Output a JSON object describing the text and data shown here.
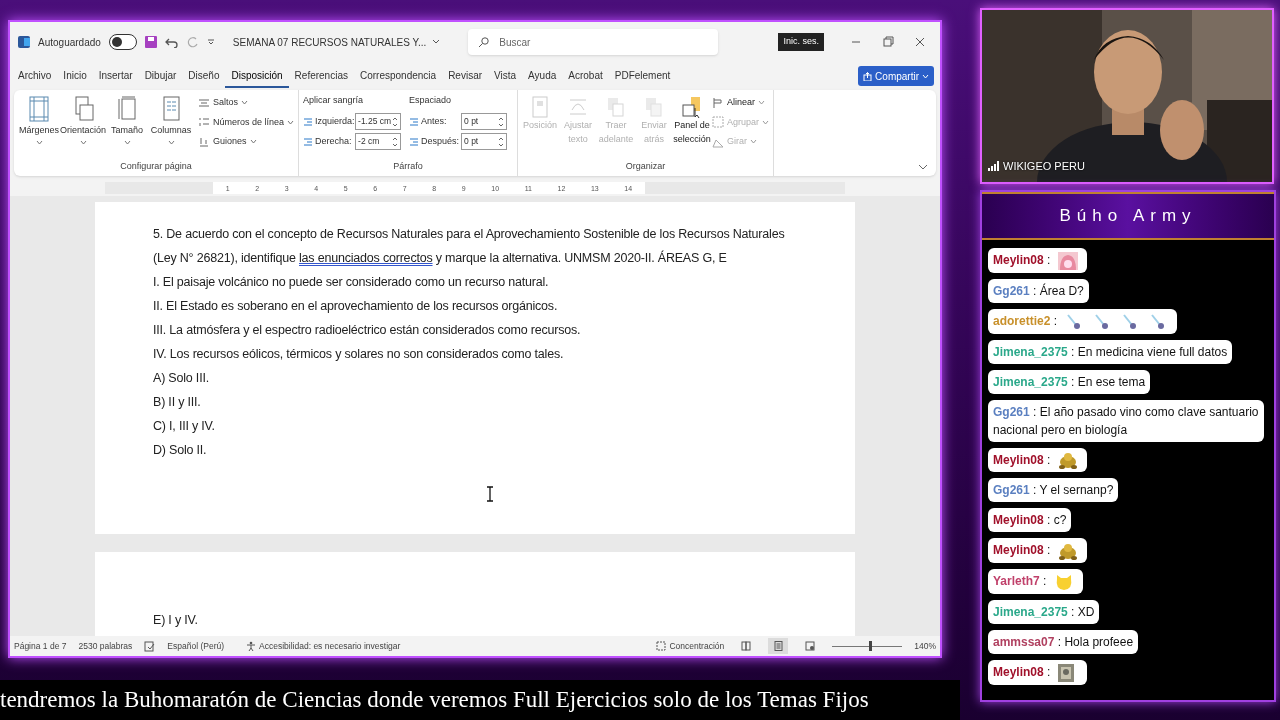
{
  "word": {
    "title_bar": {
      "autosave_label": "Autoguardado",
      "autosave_on": false,
      "doc_title": "SEMANA 07 RECURSOS NATURALES Y...",
      "search_placeholder": "Buscar",
      "signin": "Inic. ses."
    },
    "tabs": [
      {
        "label": "Archivo",
        "selected": false
      },
      {
        "label": "Inicio",
        "selected": false
      },
      {
        "label": "Insertar",
        "selected": false
      },
      {
        "label": "Dibujar",
        "selected": false
      },
      {
        "label": "Diseño",
        "selected": false
      },
      {
        "label": "Disposición",
        "selected": true
      },
      {
        "label": "Referencias",
        "selected": false
      },
      {
        "label": "Correspondencia",
        "selected": false
      },
      {
        "label": "Revisar",
        "selected": false
      },
      {
        "label": "Vista",
        "selected": false
      },
      {
        "label": "Ayuda",
        "selected": false
      },
      {
        "label": "Acrobat",
        "selected": false
      },
      {
        "label": "PDFelement",
        "selected": false
      }
    ],
    "share": "Compartir",
    "page_setup": {
      "label": "Configurar página",
      "large_buttons": [
        "Márgenes",
        "Orientación",
        "Tamaño",
        "Columnas"
      ],
      "small_buttons": [
        "Saltos",
        "Números de línea",
        "Guiones"
      ]
    },
    "paragraph": {
      "label": "Párrafo",
      "indent_label": "Aplicar sangría",
      "spacing_label": "Espaciado",
      "indent_fields": [
        {
          "label": "Izquierda:",
          "value": "-1.25 cm"
        },
        {
          "label": "Derecha:",
          "value": "-2 cm"
        }
      ],
      "spacing_fields": [
        {
          "label": "Antes:",
          "value": "0 pt"
        },
        {
          "label": "Después:",
          "value": "0 pt"
        }
      ]
    },
    "arrange": {
      "label": "Organizar",
      "large_buttons": [
        {
          "label": "Posición",
          "disabled": true
        },
        {
          "label": "Ajustar\ntexto",
          "disabled": true
        },
        {
          "label": "Traer\nadelante",
          "disabled": true
        },
        {
          "label": "Enviar\natrás",
          "disabled": true
        },
        {
          "label": "Panel de\nselección",
          "disabled": false
        }
      ],
      "small_buttons": [
        {
          "label": "Alinear",
          "disabled": false
        },
        {
          "label": "Agrupar",
          "disabled": true
        },
        {
          "label": "Girar",
          "disabled": true
        }
      ]
    },
    "ruler_numbers": [
      "1",
      "2",
      "3",
      "4",
      "5",
      "6",
      "7",
      "8",
      "9",
      "10",
      "11",
      "12",
      "13",
      "14"
    ],
    "pages": [
      {
        "lines": [
          [
            {
              "text": "5. De acuerdo con el concepto de Recursos Naturales para el Aprovechamiento Sostenible de los Recursos Naturales",
              "underline": false
            }
          ],
          [
            {
              "text": "(Ley N° 26821), identifique ",
              "underline": false
            },
            {
              "text": "las enunciados correctos",
              "underline": true
            },
            {
              "text": " y marque la alternativa. UNMSM 2020-II. ÁREAS G, E",
              "underline": false
            }
          ],
          [
            {
              "text": "I. El paisaje volcánico no puede ser considerado como un recurso natural.",
              "underline": false
            }
          ],
          [
            {
              "text": "II. El Estado es soberano en el aprovechamiento de los recursos orgánicos.",
              "underline": false
            }
          ],
          [
            {
              "text": "III. La atmósfera y el espectro radioeléctrico están considerados como recursos.",
              "underline": false
            }
          ],
          [
            {
              "text": "IV. Los recursos eólicos, térmicos y solares no son considerados como tales.",
              "underline": false
            }
          ],
          [
            {
              "text": "A) Solo III.",
              "underline": false
            }
          ],
          [
            {
              "text": "B) II y III.",
              "underline": false
            }
          ],
          [
            {
              "text": "C) I, III y IV.",
              "underline": false
            }
          ],
          [
            {
              "text": "D) Solo II.",
              "underline": false
            }
          ]
        ]
      },
      {
        "lines": [
          [
            {
              "text": "E) I y IV.",
              "underline": false
            }
          ]
        ]
      }
    ],
    "status_bar": {
      "page": "Página 1 de 7",
      "words": "2530 palabras",
      "language": "Español (Perú)",
      "accessibility": "Accesibilidad: es necesario investigar",
      "focus": "Concentración",
      "views": [
        {
          "selected": false
        },
        {
          "selected": true
        },
        {
          "selected": false
        }
      ],
      "zoom_slider": {
        "level": 0.55
      },
      "zoom": "140%"
    }
  },
  "webcam": {
    "label": "WIKIGEO PERU"
  },
  "chat": {
    "title": "Búho Army",
    "messages": [
      {
        "user": "Meylin08",
        "color": "#a0102a",
        "separator": ":",
        "emotes": [
          {
            "kind": "avatar"
          }
        ]
      },
      {
        "user": "Gg261",
        "color": "#5a7fc0",
        "separator": ":",
        "text": "Área D?"
      },
      {
        "user": "adorettie2",
        "color": "#c8902a",
        "separator": ":",
        "emotes": [
          {
            "kind": "pin"
          },
          {
            "kind": "pin"
          },
          {
            "kind": "pin"
          },
          {
            "kind": "pin"
          }
        ]
      },
      {
        "user": "Jimena_2375",
        "color": "#2aa88a",
        "separator": ":",
        "text": "En medicina viene full datos"
      },
      {
        "user": "Jimena_2375",
        "color": "#2aa88a",
        "separator": ":",
        "text": "En ese tema"
      },
      {
        "user": "Gg261",
        "color": "#5a7fc0",
        "separator": ":",
        "text": "El año pasado vino como clave santuario nacional pero en biología"
      },
      {
        "user": "Meylin08",
        "color": "#a0102a",
        "separator": ":",
        "emotes": [
          {
            "kind": "turtle"
          }
        ]
      },
      {
        "user": "Gg261",
        "color": "#5a7fc0",
        "separator": ":",
        "text": "Y el sernanp?"
      },
      {
        "user": "Meylin08",
        "color": "#a0102a",
        "separator": ":",
        "text": "c?"
      },
      {
        "user": "Meylin08",
        "color": "#a0102a",
        "separator": ":",
        "emotes": [
          {
            "kind": "turtle"
          }
        ]
      },
      {
        "user": "Yarleth7",
        "color": "#c0406a",
        "separator": ":",
        "emotes": [
          {
            "kind": "cat"
          }
        ]
      },
      {
        "user": "Jimena_2375",
        "color": "#2aa88a",
        "separator": ":",
        "text": "XD"
      },
      {
        "user": "ammssa07",
        "color": "#b04060",
        "separator": ":",
        "text": "Hola profeee"
      },
      {
        "user": "Meylin08",
        "color": "#a0102a",
        "separator": ":"
      }
    ]
  },
  "ticker": "tendremos la Buhomaratón de Ciencias donde veremos Full Ejercicios solo de los Temas Fijos"
}
